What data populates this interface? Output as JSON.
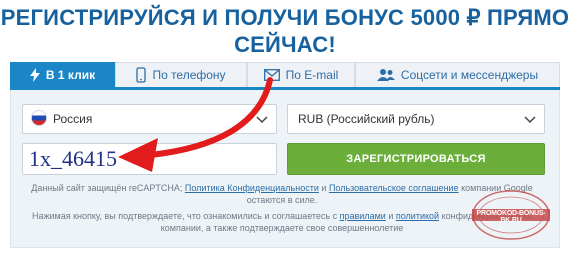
{
  "headline": {
    "line1": "РЕГИСТРИРУЙСЯ И ПОЛУЧИ БОНУС 5000 ₽ ПРЯМО",
    "line2": "СЕЙЧАС!"
  },
  "tabs": [
    {
      "label": "В 1 клик",
      "icon": "lightning-icon",
      "active": true
    },
    {
      "label": "По телефону",
      "icon": "phone-icon",
      "active": false
    },
    {
      "label": "По E-mail",
      "icon": "envelope-icon",
      "active": false
    },
    {
      "label": "Соцсети и мессенджеры",
      "icon": "people-icon",
      "active": false
    }
  ],
  "form": {
    "country": "Россия",
    "currency": "RUB (Российский рубль)",
    "promo_code": "1x_46415",
    "submit_label": "ЗАРЕГИСТРИРОВАТЬСЯ"
  },
  "recaptcha": {
    "prefix": "Данный сайт защищён reCAPTCHA;",
    "privacy_link": "Политика Конфиденциальности",
    "and": "и",
    "terms_link": "Пользовательское соглашение",
    "suffix": "компании Google остаются в силе."
  },
  "consent": {
    "prefix": "Нажимая кнопку, вы подтверждаете, что ознакомились и соглашаетесь с",
    "rules_link": "правилами",
    "and": "и",
    "policy_link": "политикой",
    "suffix": "конфиденциальности компании, а также подтверждаете свое совершеннолетие"
  },
  "stamp": {
    "text": "PROMOKOD-BONUS-BK.RU"
  },
  "colors": {
    "brand_blue": "#1a86c8",
    "headline_blue": "#17619e",
    "submit_green": "#6cae3a",
    "arrow_red": "#e21c1c",
    "promo_text": "#1f2f8a"
  }
}
